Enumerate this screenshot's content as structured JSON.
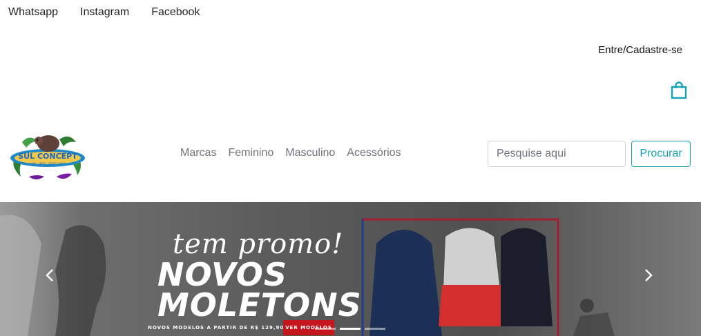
{
  "social": {
    "whatsapp": "Whatsapp",
    "instagram": "Instagram",
    "facebook": "Facebook"
  },
  "account": {
    "login_label": "Entre/Cadastre-se"
  },
  "logo": {
    "text": "SUL CONCEPT",
    "tagline": "SURF · SKATE · STREET WEAR"
  },
  "nav": {
    "items": [
      {
        "label": "Marcas"
      },
      {
        "label": "Feminino"
      },
      {
        "label": "Masculino"
      },
      {
        "label": "Acessórios"
      }
    ]
  },
  "search": {
    "placeholder": "Pesquise aqui",
    "button_label": "Procurar"
  },
  "banner": {
    "script_text": "tem promo!",
    "headline_1": "NOVOS",
    "headline_2": "MOLETONS",
    "subtext": "NOVOS MODELOS A PARTIR DE R$ 129,90",
    "cta_label": "VER MODELOS",
    "prev_icon": "chevron-left",
    "next_icon": "chevron-right",
    "slide_count": 3,
    "active_slide": 2
  },
  "colors": {
    "accent": "#17a2b8",
    "cta": "#c4161c"
  }
}
